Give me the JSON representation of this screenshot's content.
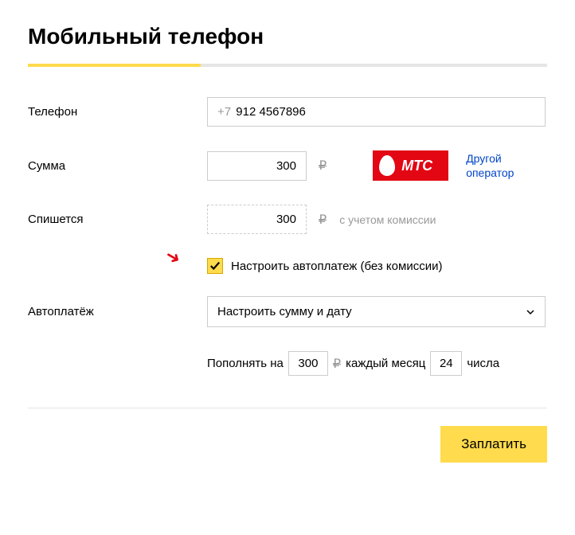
{
  "title": "Мобильный телефон",
  "phone": {
    "label": "Телефон",
    "prefix": "+7",
    "value": "912 4567896"
  },
  "amount": {
    "label": "Сумма",
    "value": "300",
    "currency": "₽",
    "operator_name": "МТС",
    "other_operator_link": "Другой оператор"
  },
  "charged": {
    "label": "Спишется",
    "value": "300",
    "currency": "₽",
    "note": "с учетом комиссии"
  },
  "autopay_checkbox": {
    "checked": true,
    "label": "Настроить автоплатеж (без комиссии)"
  },
  "autopay": {
    "label": "Автоплатёж",
    "select_value": "Настроить сумму и дату",
    "details": {
      "prefix": "Пополнять на",
      "amount": "300",
      "currency": "₽",
      "middle": "каждый месяц",
      "day": "24",
      "suffix": "числа"
    }
  },
  "pay_button": "Заплатить"
}
